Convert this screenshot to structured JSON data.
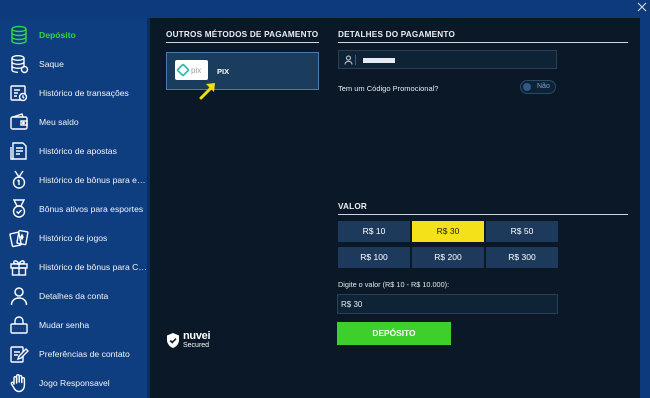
{
  "sidebar": {
    "items": [
      {
        "label": "Depósito",
        "icon": "coins-stack-icon",
        "active": true
      },
      {
        "label": "Saque",
        "icon": "coins-withdraw-icon",
        "active": false
      },
      {
        "label": "Histórico de transações",
        "icon": "transactions-history-icon",
        "active": false
      },
      {
        "label": "Meu saldo",
        "icon": "wallet-icon",
        "active": false
      },
      {
        "label": "Histórico de apostas",
        "icon": "bets-history-icon",
        "active": false
      },
      {
        "label": "Histórico de bônus para es...",
        "icon": "medal-icon",
        "active": false
      },
      {
        "label": "Bônus ativos para esportes",
        "icon": "medal-check-icon",
        "active": false
      },
      {
        "label": "Histórico de jogos",
        "icon": "cards-icon",
        "active": false
      },
      {
        "label": "Histórico de bônus para Ca...",
        "icon": "gift-icon",
        "active": false
      },
      {
        "label": "Detalhes da conta",
        "icon": "user-icon",
        "active": false
      },
      {
        "label": "Mudar senha",
        "icon": "password-icon",
        "active": false
      },
      {
        "label": "Preferências de contato",
        "icon": "contact-edit-icon",
        "active": false
      },
      {
        "label": "Jogo Responsavel",
        "icon": "hand-icon",
        "active": false
      }
    ]
  },
  "left_panel": {
    "title": "OUTROS MÉTODOS DE PAGAMENTO",
    "method": {
      "label": "PIX",
      "logo_text": "pix"
    },
    "secured_brand": "nuvei",
    "secured_text": "Secured"
  },
  "details": {
    "title": "DETALHES DO PAGAMENTO",
    "name_value": "",
    "promo_label": "Tem um Código Promocional?",
    "promo_toggle": "Não"
  },
  "valor": {
    "title": "VALOR",
    "amounts": [
      "R$ 10",
      "R$ 30",
      "R$ 50",
      "R$ 100",
      "R$ 200",
      "R$ 300"
    ],
    "selected": "R$ 30",
    "input_label": "Digite o valor (R$ 10 - R$ 10.000):",
    "input_value": "R$ 30"
  },
  "deposit_button": "DEPÓSITO",
  "colors": {
    "sidebar_bg": "#0e3d80",
    "main_bg": "#0b1827",
    "accent_green": "#3fcf2a",
    "selected_yellow": "#f5e11a",
    "amount_bg": "#1d3a5c"
  }
}
